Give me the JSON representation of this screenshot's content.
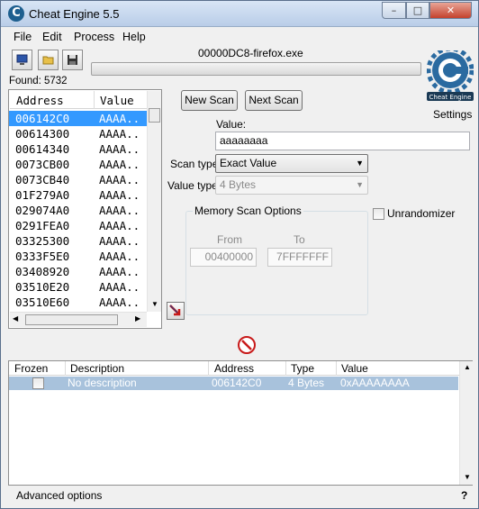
{
  "window": {
    "title": "Cheat Engine 5.5",
    "min": "–",
    "max": "□",
    "close": "✕"
  },
  "menu": [
    "File",
    "Edit",
    "Process",
    "Help"
  ],
  "toolbar": {
    "process_name": "00000DC8-firefox.exe",
    "found": "Found: 5732",
    "settings_label": "Settings",
    "logo_text": "Cheat Engine"
  },
  "results": {
    "columns": [
      "Address",
      "Value"
    ],
    "rows": [
      {
        "address": "006142C0",
        "value": "AAAA.."
      },
      {
        "address": "00614300",
        "value": "AAAA.."
      },
      {
        "address": "00614340",
        "value": "AAAA.."
      },
      {
        "address": "0073CB00",
        "value": "AAAA.."
      },
      {
        "address": "0073CB40",
        "value": "AAAA.."
      },
      {
        "address": "01F279A0",
        "value": "AAAA.."
      },
      {
        "address": "029074A0",
        "value": "AAAA.."
      },
      {
        "address": "0291FEA0",
        "value": "AAAA.."
      },
      {
        "address": "03325300",
        "value": "AAAA.."
      },
      {
        "address": "0333F5E0",
        "value": "AAAA.."
      },
      {
        "address": "03408920",
        "value": "AAAA.."
      },
      {
        "address": "03510E20",
        "value": "AAAA.."
      },
      {
        "address": "03510E60",
        "value": "AAAA.."
      }
    ]
  },
  "scan": {
    "new_scan": "New Scan",
    "next_scan": "Next Scan",
    "value_label": "Value:",
    "value": "aaaaaaaa",
    "scan_type_label": "Scan type",
    "scan_type": "Exact Value",
    "value_type_label": "Value type",
    "value_type": "4 Bytes",
    "memory_options_title": "Memory Scan Options",
    "from_label": "From",
    "from_value": "00400000",
    "to_label": "To",
    "to_value": "7FFFFFFF",
    "unrandomizer_label": "Unrandomizer",
    "unrandomizer_checked": false
  },
  "address_list": {
    "columns": [
      "Frozen",
      "Description",
      "Address",
      "Type",
      "Value"
    ],
    "rows": [
      {
        "frozen": false,
        "description": "No description",
        "address": "006142C0",
        "type": "4 Bytes",
        "value": "0xAAAAAAAA"
      }
    ]
  },
  "status": {
    "advanced_options": "Advanced options",
    "help": "?"
  },
  "colors": {
    "selection": "#3399ff",
    "address_row": "#a8c2dc",
    "stop": "#c81a1a"
  }
}
